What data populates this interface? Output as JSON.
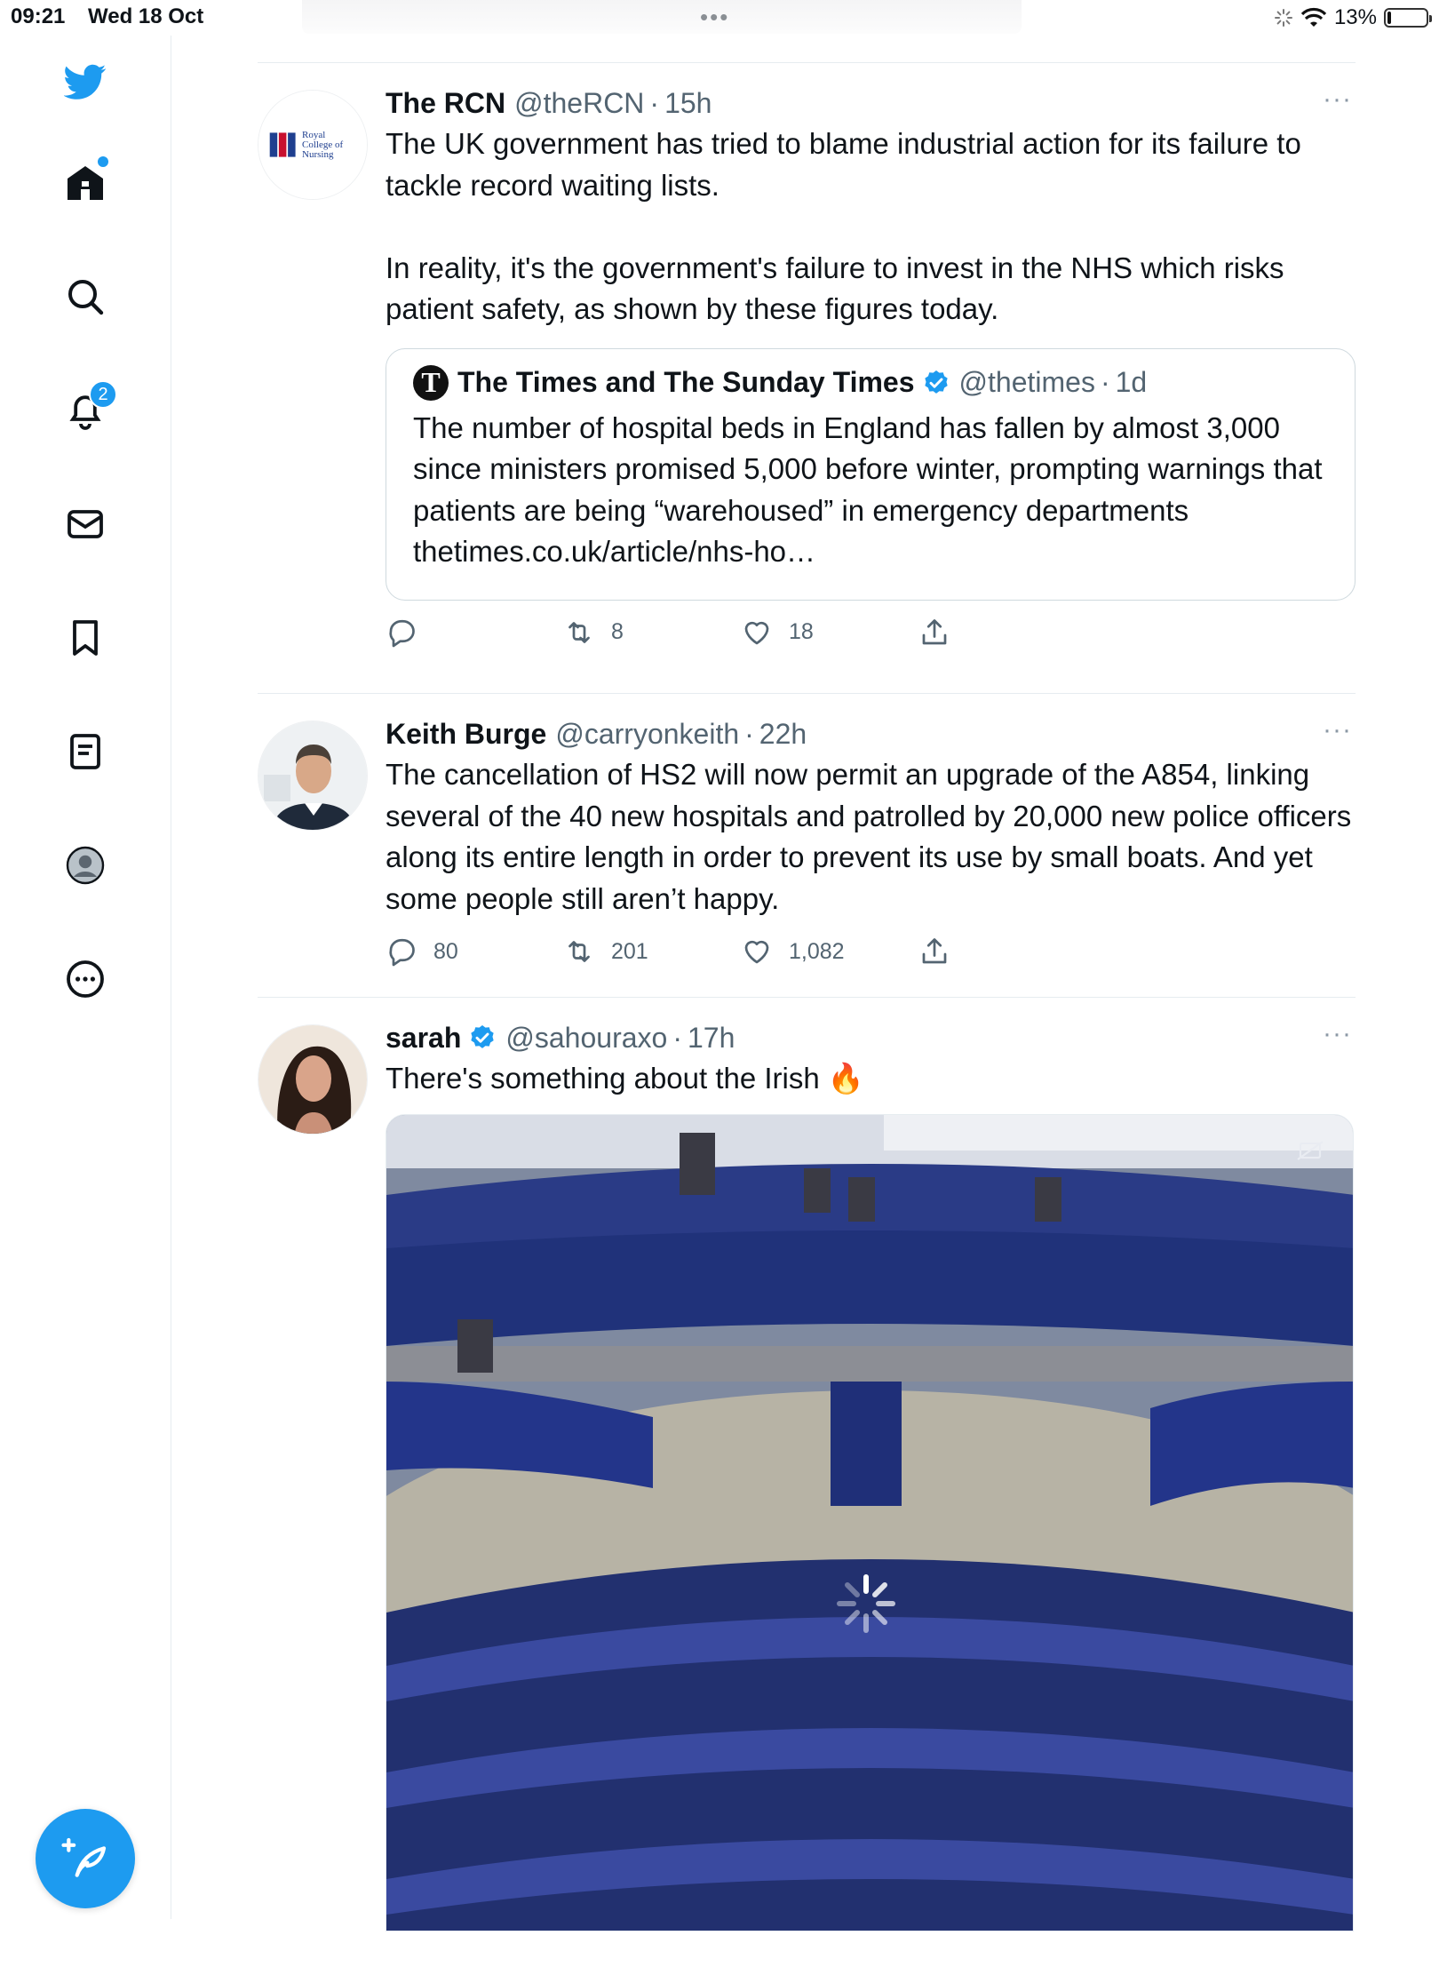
{
  "status_bar": {
    "time": "09:21",
    "date": "Wed 18 Oct",
    "dots": "•••",
    "battery": "13%"
  },
  "nav": {
    "items": [
      "home",
      "search",
      "notifications",
      "messages",
      "bookmarks",
      "lists",
      "profile",
      "more"
    ],
    "notifications_badge": "2"
  },
  "tweets": [
    {
      "name": "The RCN",
      "handle": "@theRCN",
      "time": "15h",
      "avatar_text": "Royal College of Nursing",
      "text": "The UK government has tried to blame industrial action for its failure to tackle record waiting lists.\n\nIn reality, it's the government's failure to invest in the NHS which risks patient safety, as shown by these figures today.",
      "quote": {
        "name": "The Times and The Sunday Times",
        "handle": "@thetimes",
        "time": "1d",
        "text": "The number of hospital beds in England has fallen by almost 3,000 since ministers promised 5,000 before winter, prompting warnings that patients are being “warehoused” in emergency departments thetimes.co.uk/article/nhs-ho…"
      },
      "replies": "",
      "retweets": "8",
      "likes": "18"
    },
    {
      "name": "Keith Burge",
      "handle": "@carryonkeith",
      "time": "22h",
      "text": "The cancellation of HS2 will now permit an upgrade of the A854, linking several of the 40 new hospitals and patrolled by 20,000 new police officers along its entire length in order to prevent its use by small boats. And yet some people still aren’t happy.",
      "replies": "80",
      "retweets": "201",
      "likes": "1,082"
    },
    {
      "name": "sarah",
      "handle": "@sahouraxo",
      "time": "17h",
      "text": "There's something about the Irish 🔥"
    }
  ],
  "sep": "·",
  "more_glyph": "···",
  "colors": {
    "accent": "#1d9bf0",
    "text": "#0f1419",
    "muted": "#536471",
    "border": "#e6ecf0"
  }
}
